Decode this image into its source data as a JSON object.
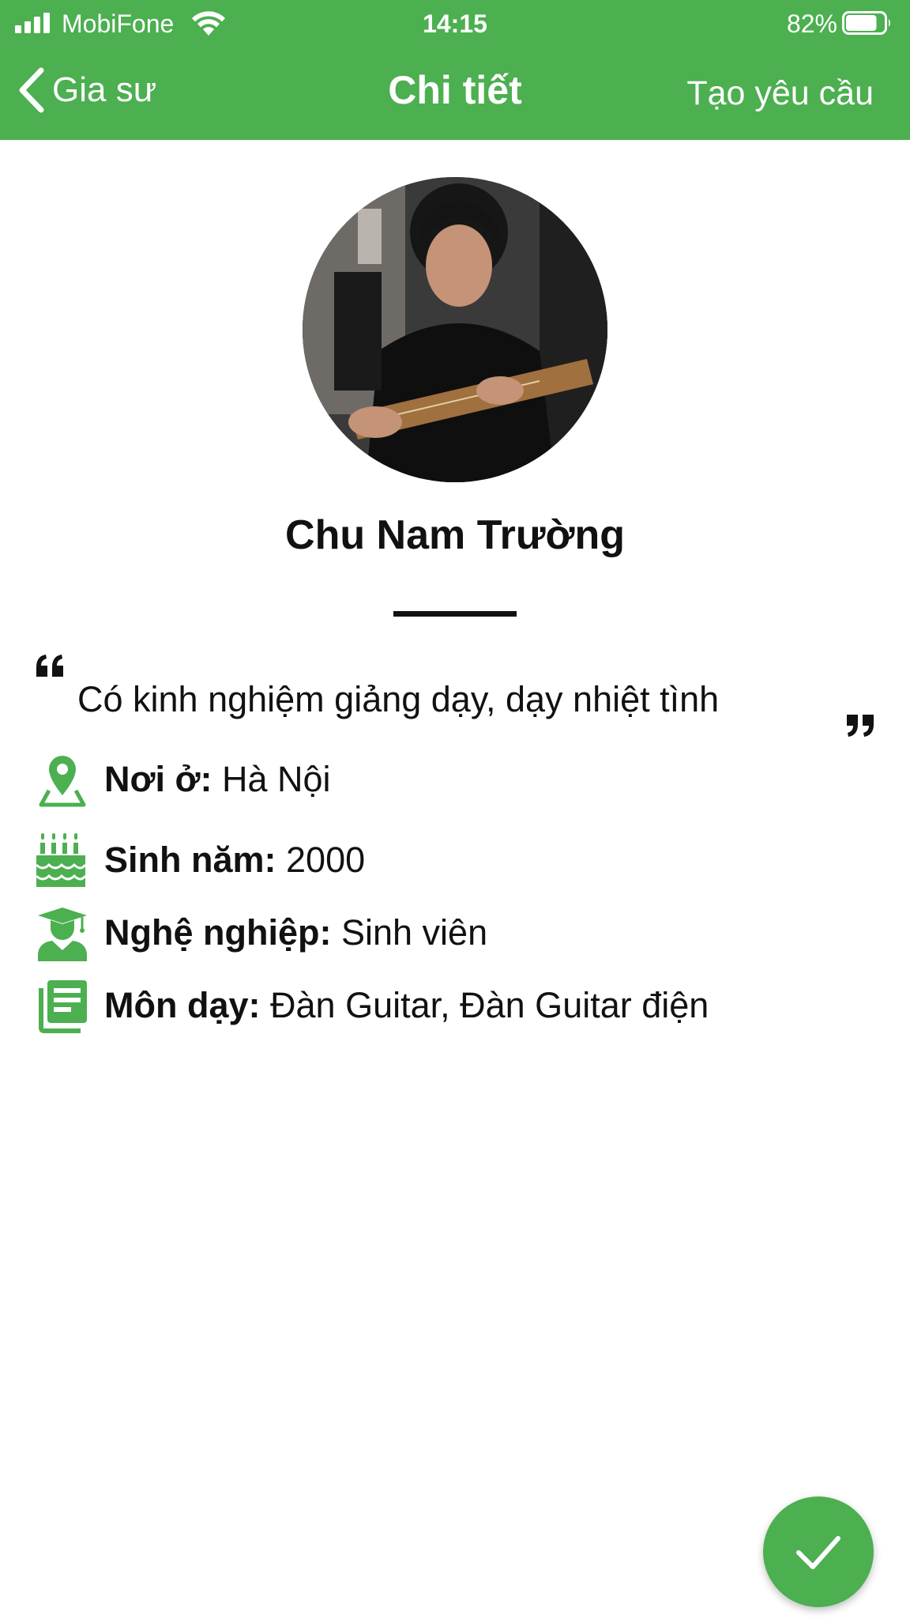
{
  "status_bar": {
    "carrier": "MobiFone",
    "time": "14:15",
    "battery_percent": "82%",
    "battery_level": 0.82
  },
  "nav": {
    "back_label": "Gia sư",
    "title": "Chi tiết",
    "action_label": "Tạo yêu cầu"
  },
  "profile": {
    "name": "Chu Nam Trường",
    "quote": "Có kinh nghiệm giảng dạy, dạy nhiệt tình"
  },
  "info": [
    {
      "icon": "location-pin-icon",
      "label": "Nơi ở:",
      "value": "Hà Nội"
    },
    {
      "icon": "birthday-cake-icon",
      "label": "Sinh năm:",
      "value": "2000"
    },
    {
      "icon": "graduate-icon",
      "label": "Nghệ nghiệp:",
      "value": "Sinh viên"
    },
    {
      "icon": "subjects-list-icon",
      "label": "Môn dạy:",
      "value": "Đàn Guitar, Đàn Guitar điện"
    }
  ],
  "fab": {
    "icon": "checkmark-icon"
  },
  "colors": {
    "primary": "#4caf50",
    "text": "#111111",
    "background": "#ffffff"
  }
}
